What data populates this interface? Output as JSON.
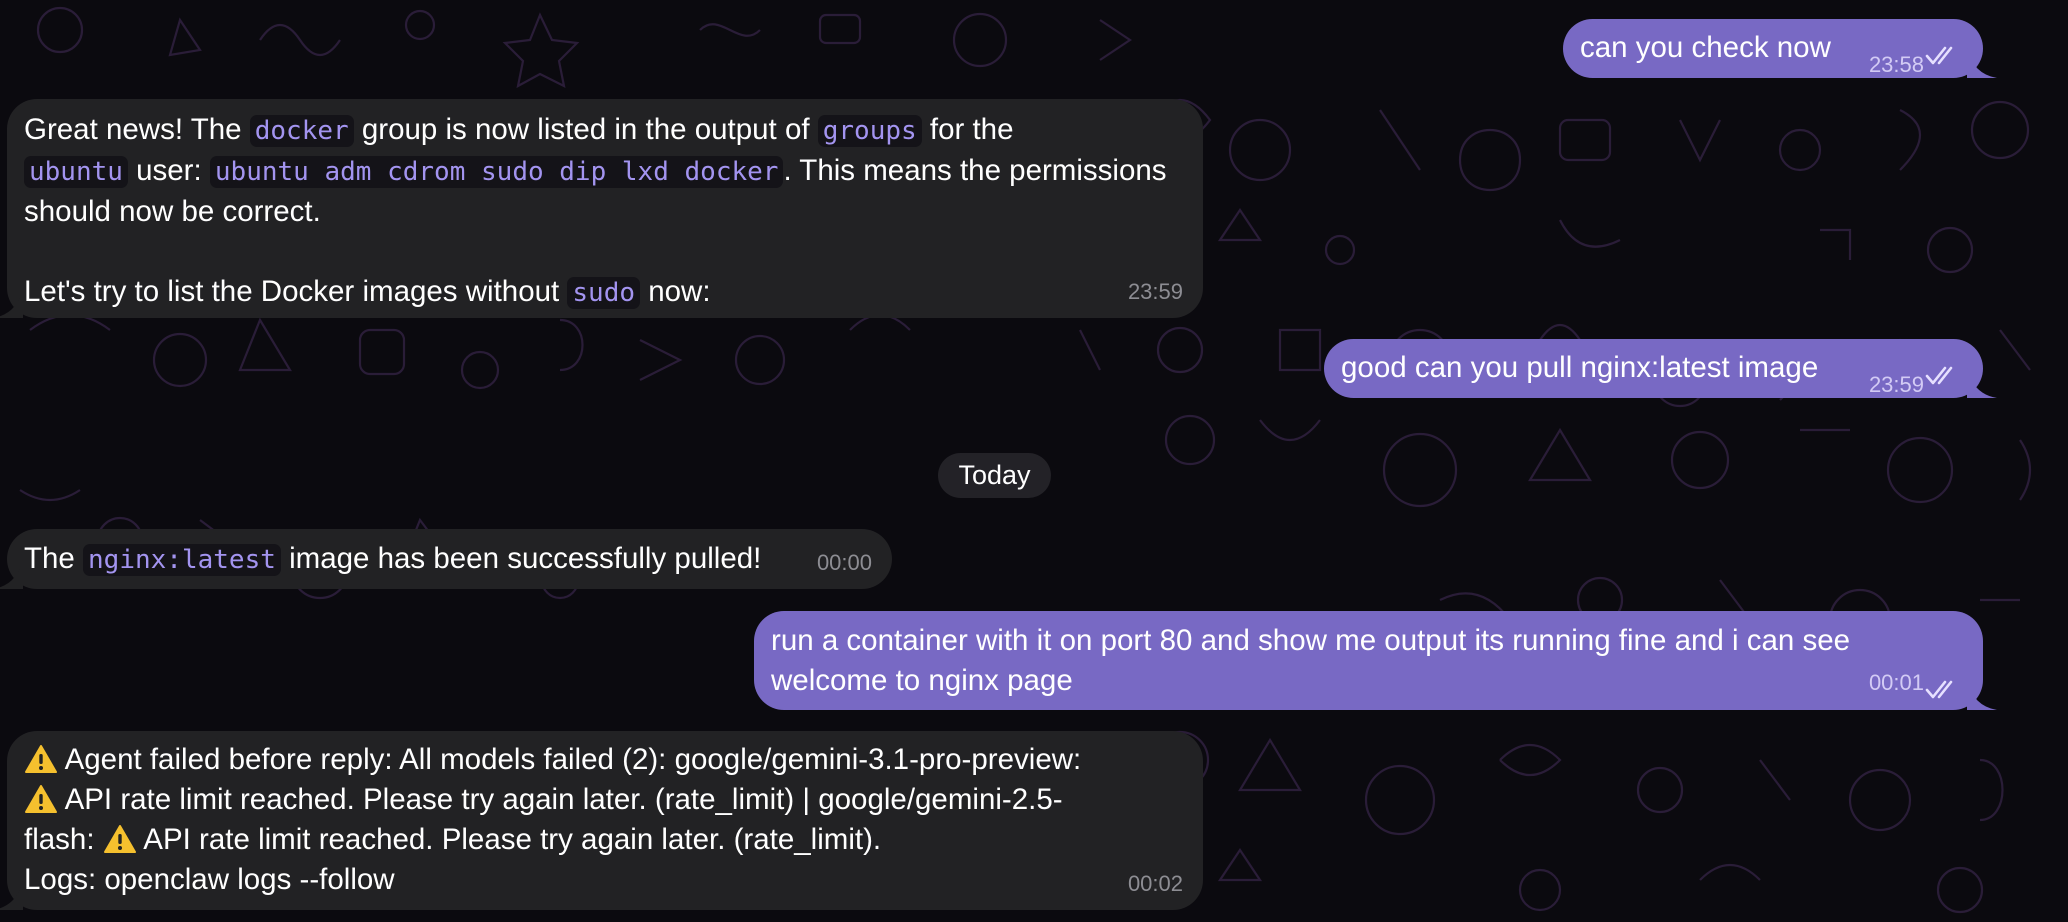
{
  "colors": {
    "background": "#0b0a0f",
    "incoming_bubble": "#222224",
    "outgoing_bubble": "#7869c4",
    "code_text": "#a394f0"
  },
  "date_separator": "Today",
  "messages": [
    {
      "dir": "out",
      "text": "can you check now",
      "time": "23:58",
      "status": "read-double-check-icon"
    },
    {
      "dir": "in",
      "time": "23:59",
      "p1": {
        "t1": "Great news! The ",
        "c1": "docker",
        "t2": " group is now listed in the output of ",
        "c2": "groups",
        "t3": " for the",
        "c3": "ubuntu",
        "t4": " user: ",
        "c4": "ubuntu adm cdrom sudo dip lxd docker",
        "t5": ". This means the permissions",
        "t6": "should now be correct."
      },
      "p2": {
        "t1": "Let's try to list the Docker images without ",
        "c1": "sudo",
        "t2": " now:"
      }
    },
    {
      "dir": "out",
      "text": "good can you pull nginx:latest image",
      "time": "23:59",
      "status": "read-double-check-icon"
    },
    {
      "dir": "in",
      "t1": "The ",
      "c1": "nginx:latest",
      "t2": " image has been successfully pulled!",
      "time": "00:00"
    },
    {
      "dir": "out",
      "line1": "run a container with it on port 80 and show me output its running fine and i can see",
      "line2": "welcome to nginx page",
      "time": "00:01",
      "status": "read-double-check-icon"
    },
    {
      "dir": "in",
      "time": "00:02",
      "l1": "Agent failed before reply: All models failed (2): google/gemini-3.1-pro-preview:",
      "l2": "API rate limit reached. Please try again later. (rate_limit) | google/gemini-2.5-",
      "l3a": "flash: ",
      "l3b": "API rate limit reached. Please try again later. (rate_limit).",
      "l4": "Logs: openclaw logs --follow",
      "icon": "warning-icon"
    }
  ]
}
